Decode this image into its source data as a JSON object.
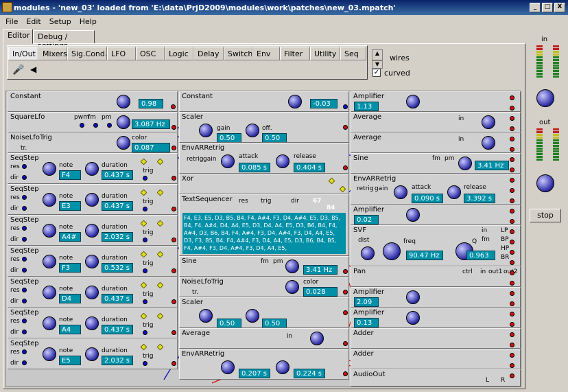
{
  "window": {
    "title": "modules - 'new_03' loaded from 'E:\\data\\PrjD2009\\modules\\work\\patches\\new_03.mpatch'",
    "min": "_",
    "max": "□",
    "close": "X"
  },
  "menu": [
    "File",
    "Edit",
    "Setup",
    "Help"
  ],
  "tabs": {
    "editor": "Editor",
    "debug": "Debug / settings"
  },
  "palette_tabs": [
    "In/Out",
    "Mixers",
    "Sig.Cond.",
    "LFO",
    "OSC",
    "Logic",
    "Delay",
    "Switch",
    "Env",
    "Filter",
    "Utility",
    "Seq"
  ],
  "wires_label": "wires",
  "curved_label": "curved",
  "meters": {
    "in": "in",
    "out": "out"
  },
  "stop_label": "stop",
  "col1": [
    {
      "title": "Constant",
      "value": "0.98"
    },
    {
      "title": "SquareLfo",
      "value": "3.087 Hz",
      "labels": [
        "pwm",
        "fm",
        "pm"
      ]
    },
    {
      "title": "NoiseLfoTrig",
      "value": "0.087",
      "knob": "color",
      "sub": "tr."
    },
    {
      "title": "SeqStep",
      "value": "F4",
      "dur": "0.437 s"
    },
    {
      "title": "SeqStep",
      "value": "E3",
      "dur": "0.437 s"
    },
    {
      "title": "SeqStep",
      "value": "A4#",
      "dur": "2.032 s"
    },
    {
      "title": "SeqStep",
      "value": "F3",
      "dur": "0.532 s"
    },
    {
      "title": "SeqStep",
      "value": "D4",
      "dur": "0.437 s"
    },
    {
      "title": "SeqStep",
      "value": "A4",
      "dur": "0.437 s"
    },
    {
      "title": "SeqStep",
      "value": "E5",
      "dur": "2.032 s"
    }
  ],
  "seq_labels": {
    "note": "note",
    "duration": "duration",
    "res": "res",
    "dir": "dir",
    "trig": "trig"
  },
  "col2": {
    "constant": {
      "title": "Constant",
      "value": "-0.03"
    },
    "scaler1": {
      "title": "Scaler",
      "gain": "0.50",
      "off": "0.50",
      "gain_l": "gain",
      "off_l": "off."
    },
    "env1": {
      "title": "EnvARRetrig",
      "attack": "0.085 s",
      "release": "0.404 s",
      "retrig": "retrig",
      "gain": "gain",
      "att_l": "attack",
      "rel_l": "release"
    },
    "xor": {
      "title": "Xor"
    },
    "textseq": {
      "title": "TextSequencer",
      "res": "res",
      "trig": "trig",
      "dir": "dir",
      "count": "67",
      "total": "84",
      "text": "F4, E3, E5, D3, B5, B4, F4, A#4, F3, D4, A#4, E5, D3, B5, B4, F4, A#4, D4, A4, E5, D3, D4, A4, E5, D3, B6, B4, F4, A#4, D3, B6, B4, F4, A#4, F3, D4, A#4, F3, D4, A4, E5, D3, F3, B5, B4, F4, A#4, F3, D4, A4, E5, D3, B6, B4, B5, F4, A#4, F3, D4, A#4, F3, D4, A4, E5,"
    },
    "sine": {
      "title": "Sine",
      "value": "3.41 Hz",
      "fm": "fm",
      "pm": "pm"
    },
    "noise": {
      "title": "NoiseLfoTrig",
      "value": "0.028",
      "color": "color",
      "tr": "tr."
    },
    "scaler2": {
      "title": "Scaler",
      "gain": "0.50",
      "off": "0.50"
    },
    "average": {
      "title": "Average",
      "in": "in"
    },
    "env2": {
      "title": "EnvARRetrig",
      "attack": "0.207 s",
      "release": "0.224 s"
    }
  },
  "col3": {
    "amp1": {
      "title": "Amplifier",
      "value": "1.13"
    },
    "avg1": {
      "title": "Average",
      "in": "in"
    },
    "avg2": {
      "title": "Average",
      "in": "in"
    },
    "sine": {
      "title": "Sine",
      "value": "3.41 Hz",
      "fm": "fm",
      "pm": "pm"
    },
    "env": {
      "title": "EnvARRetrig",
      "retrig": "retrig",
      "gain": "gain",
      "attack": "0.090 s",
      "release": "3.392 s",
      "att_l": "attack",
      "rel_l": "release"
    },
    "amp2": {
      "title": "Amplifier",
      "value": "0.02"
    },
    "svf": {
      "title": "SVF",
      "dist": "dist",
      "freq": "freq",
      "q": "Q",
      "freq_v": "90.47 Hz",
      "q_v": "0.963",
      "outs": [
        "LP",
        "BP",
        "HP",
        "BR"
      ],
      "in": "in",
      "fm": "fm"
    },
    "pan": {
      "title": "Pan",
      "ctrl": "ctrl",
      "in": "in",
      "out1": "out1",
      "out2": "out2"
    },
    "amp3": {
      "title": "Amplifier",
      "value": "2.09"
    },
    "amp4": {
      "title": "Amplifier",
      "value": "0.13"
    },
    "adder1": {
      "title": "Adder"
    },
    "adder2": {
      "title": "Adder"
    },
    "audioout": {
      "title": "AudioOut",
      "l": "L",
      "r": "R"
    }
  }
}
